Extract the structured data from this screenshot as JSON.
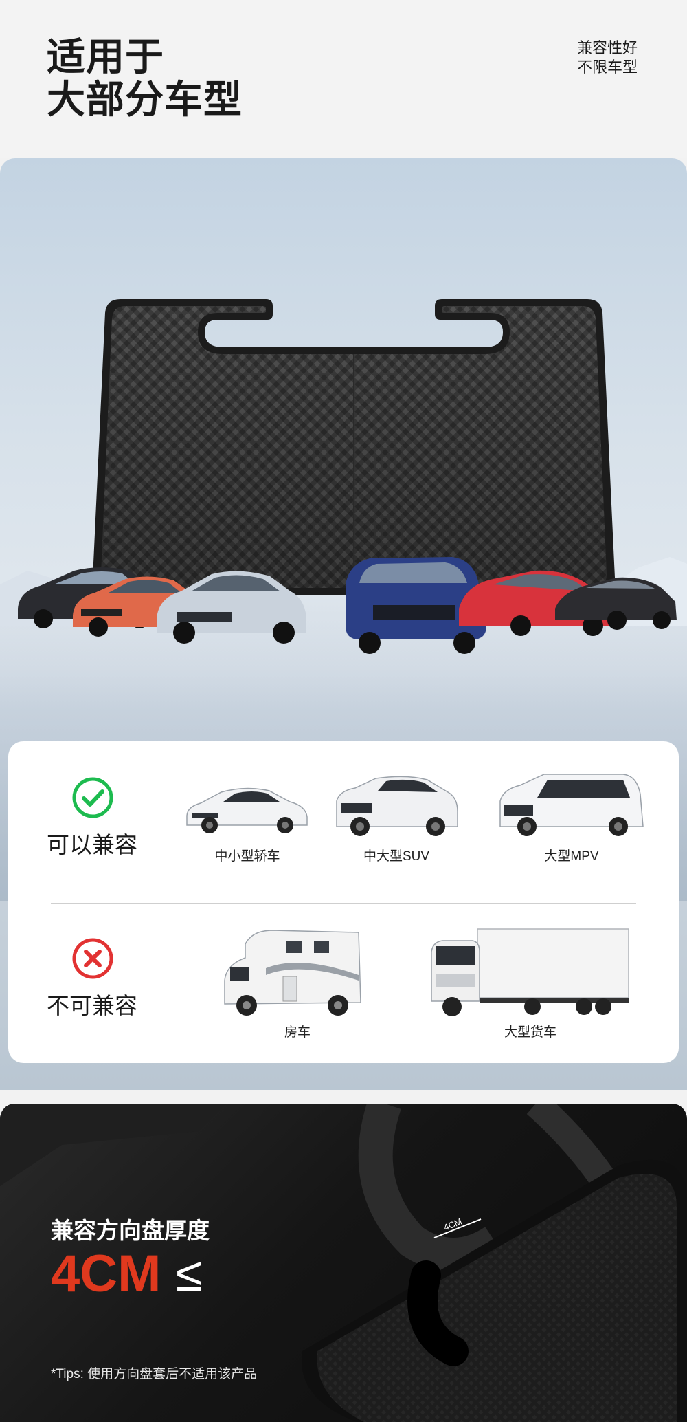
{
  "header": {
    "title_line1": "适用于",
    "title_line2": "大部分车型",
    "tagline_line1": "兼容性好",
    "tagline_line2": "不限车型"
  },
  "compatibility": {
    "compatible": {
      "label": "可以兼容",
      "icon": "check-circle-icon",
      "color": "#1dbb4f",
      "vehicles": [
        "中小型轿车",
        "中大型SUV",
        "大型MPV"
      ]
    },
    "incompatible": {
      "label": "不可兼容",
      "icon": "cross-circle-icon",
      "color": "#e23232",
      "vehicles": [
        "房车",
        "大型货车"
      ]
    }
  },
  "thickness": {
    "heading": "兼容方向盘厚度",
    "value": "4CM",
    "symbol": "≤",
    "measure_label": "4CM",
    "tip": "*Tips: 使用方向盘套后不适用该产品",
    "accent_color": "#e0391e"
  }
}
